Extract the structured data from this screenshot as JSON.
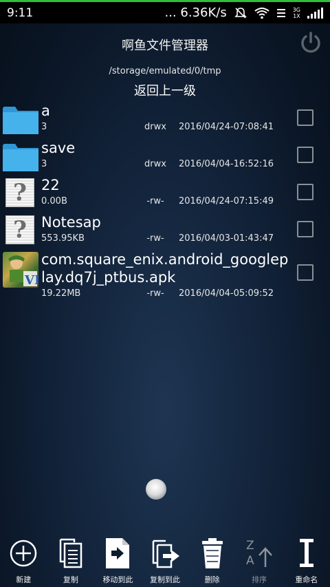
{
  "status_bar": {
    "time": "9:11",
    "net_speed": "... 6.36K/s",
    "net_badge_top": "3G",
    "net_badge_bottom": "1X",
    "icons": [
      "mute-icon",
      "wifi-icon",
      "data-icon",
      "signal-icon"
    ]
  },
  "header": {
    "title": "啊鱼文件管理器",
    "power_icon": "power-icon",
    "path": "/storage/emulated/0/tmp",
    "up_label": "返回上一级"
  },
  "files": [
    {
      "name": "a",
      "size": "3",
      "perm": "drwx",
      "date": "2016/04/24-07:08:41",
      "icon": "folder-icon"
    },
    {
      "name": "save",
      "size": "3",
      "perm": "drwx",
      "date": "2016/04/04-16:52:16",
      "icon": "folder-icon"
    },
    {
      "name": "22",
      "size": "0.00B",
      "perm": "-rw-",
      "date": "2016/04/24-07:15:49",
      "icon": "unknown-file-icon"
    },
    {
      "name": "Notesap",
      "size": "553.95KB",
      "perm": "-rw-",
      "date": "2016/04/03-01:43:47",
      "icon": "unknown-file-icon"
    },
    {
      "name": "com.square_enix.android_googleplay.dq7j_ptbus.apk",
      "size": "19.22MB",
      "perm": "-rw-",
      "date": "2016/04/04-05:09:52",
      "icon": "apk-icon"
    }
  ],
  "toolbar": {
    "new": "新建",
    "copy": "复制",
    "move_here": "移动到此",
    "copy_here": "复制到此",
    "delete": "删除",
    "sort": "排序",
    "rename": "重命名"
  },
  "colors": {
    "accent_green": "#2fbf3a",
    "background": "#12233a",
    "checkbox_border": "#8a8f96",
    "folder_blue": "#36a6e3"
  }
}
